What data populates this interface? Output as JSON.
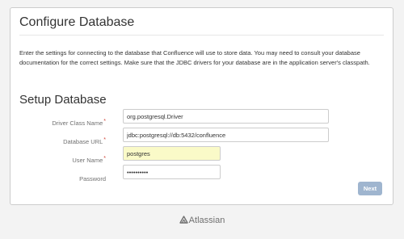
{
  "page": {
    "title": "Configure Database",
    "intro": "Enter the settings for connecting to the database that Confluence will use to store data. You may need to consult your database documentation for the correct settings. Make sure that the JDBC drivers for your database are in the application server's classpath."
  },
  "setup": {
    "heading": "Setup Database",
    "required_marker": "*",
    "fields": [
      {
        "label": "Driver Class Name",
        "value": "org.postgresql.Driver",
        "required": true
      },
      {
        "label": "Database URL",
        "value": "jdbc:postgresql://db:5432/confluence",
        "required": true
      },
      {
        "label": "User Name",
        "value": "postgres",
        "required": true
      },
      {
        "label": "Password",
        "value": "••••••••••",
        "required": false
      }
    ],
    "next_label": "Next"
  },
  "footer": {
    "logo_text": "Atlassian",
    "logo_icon": "atlassian-logo-icon"
  },
  "colors": {
    "required": "#d04437",
    "button": "#9fb5cf",
    "highlight": "#fafac8",
    "logo": "#707070"
  }
}
